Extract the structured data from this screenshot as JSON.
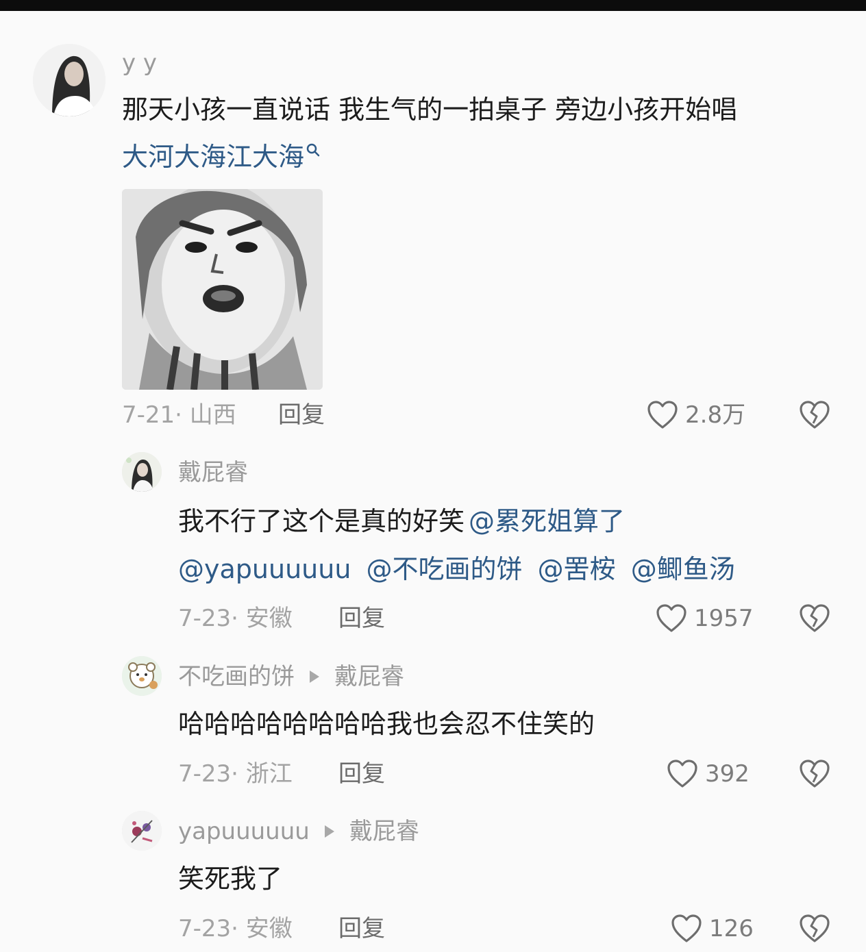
{
  "comments": [
    {
      "username": "y y",
      "text": "那天小孩一直说话 我生气的一拍桌子 旁边小孩开始唱",
      "search_link": "大河大海江大海",
      "date_location": "7-21· 山西",
      "reply_label": "回复",
      "likes": "2.8万"
    },
    {
      "username": "戴屁睿",
      "text": "我不行了这个是真的好笑",
      "mentions": [
        "@累死姐算了",
        "@yapuuuuuu",
        "@不吃画的饼",
        "@罟桉",
        "@鲫鱼汤"
      ],
      "date_location": "7-23· 安徽",
      "reply_label": "回复",
      "likes": "1957"
    },
    {
      "username": "不吃画的饼",
      "reply_to": "戴屁睿",
      "text": "哈哈哈哈哈哈哈哈我也会忍不住笑的",
      "date_location": "7-23· 浙江",
      "reply_label": "回复",
      "likes": "392"
    },
    {
      "username": "yapuuuuuu",
      "reply_to": "戴屁睿",
      "text": "笑死我了",
      "date_location": "7-23· 安徽",
      "reply_label": "回复",
      "likes": "126"
    }
  ],
  "icons": {
    "like": "heart-outline-icon",
    "dislike": "broken-heart-icon",
    "search": "search-icon",
    "reply_arrow": "triangle-right-icon"
  },
  "colors": {
    "mention": "#2e5a87",
    "text": "#1c1c1c",
    "meta": "#a3a3a3"
  }
}
